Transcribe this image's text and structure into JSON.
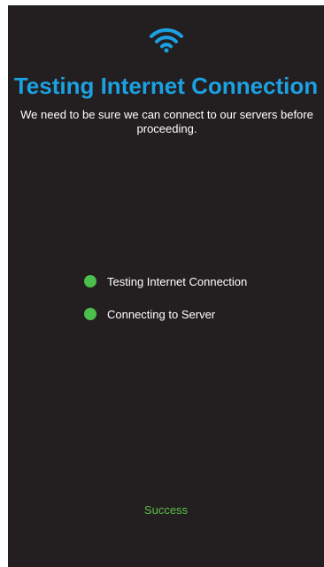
{
  "header": {
    "icon": "wifi-icon",
    "title": "Testing Internet Connection",
    "subtitle": "We need to be sure we can connect to our servers before proceeding."
  },
  "checks": [
    {
      "label": "Testing Internet Connection",
      "state": "complete",
      "color": "#4bbf4b"
    },
    {
      "label": "Connecting to Server",
      "state": "complete",
      "color": "#4bbf4b"
    }
  ],
  "status": {
    "text": "Success",
    "color": "#5cbf4a"
  },
  "colors": {
    "background": "#231f20",
    "accent": "#1ba1e2",
    "text": "#ffffff"
  }
}
